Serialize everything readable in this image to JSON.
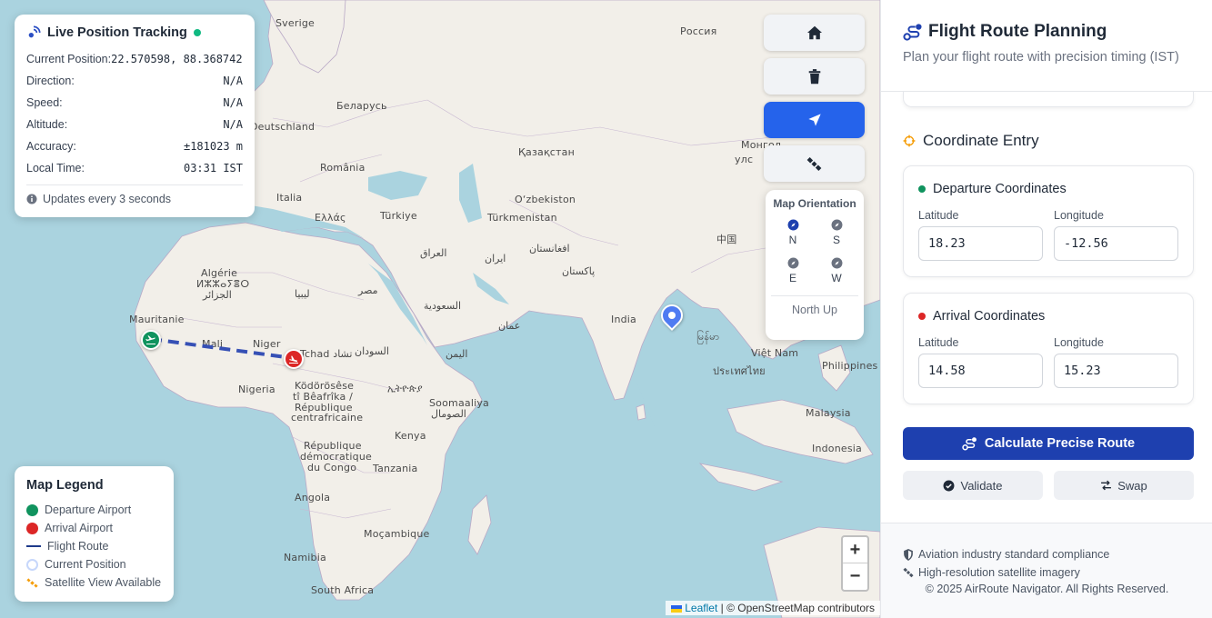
{
  "map": {
    "places": [
      {
        "name": "Sverige"
      },
      {
        "name": "Россия"
      },
      {
        "name": "Беларусь"
      },
      {
        "name": "Deutschland"
      },
      {
        "name": "România"
      },
      {
        "name": "Қазақстан"
      },
      {
        "name": "Italia"
      },
      {
        "name": "Ελλάς"
      },
      {
        "name": "Türkiye"
      },
      {
        "name": "O‘zbekiston"
      },
      {
        "name": "Türkmenistan"
      },
      {
        "name": "Монгол"
      },
      {
        "name": "улс"
      },
      {
        "name": "中国"
      },
      {
        "name": "افغانستان"
      },
      {
        "name": "العراق"
      },
      {
        "name": "ایران"
      },
      {
        "name": "پاکستان"
      },
      {
        "name": "Algérie"
      },
      {
        "name": "ⵍⵣⵣⴰⵢⴻⵔ"
      },
      {
        "name": "الجزائر"
      },
      {
        "name": "ليبيا"
      },
      {
        "name": "مصر"
      },
      {
        "name": "السعودية"
      },
      {
        "name": "India"
      },
      {
        "name": "Mauritanie"
      },
      {
        "name": "Mali"
      },
      {
        "name": "Niger"
      },
      {
        "name": "Tchad تشاد"
      },
      {
        "name": "السودان"
      },
      {
        "name": "اليمن"
      },
      {
        "name": "عمان"
      },
      {
        "name": "Nigeria"
      },
      {
        "name": "Ködörösêse"
      },
      {
        "name": "tî Bêafrîka /"
      },
      {
        "name": "République"
      },
      {
        "name": "centrafricaine"
      },
      {
        "name": "ኢትዮጵያ"
      },
      {
        "name": "Soomaaliya"
      },
      {
        "name": "الصومال"
      },
      {
        "name": "Kenya"
      },
      {
        "name": "République"
      },
      {
        "name": "démocratique"
      },
      {
        "name": "du Congo"
      },
      {
        "name": "Tanzania"
      },
      {
        "name": "Angola"
      },
      {
        "name": "Moçambique"
      },
      {
        "name": "Namibia"
      },
      {
        "name": "South Africa"
      },
      {
        "name": "Việt Nam"
      },
      {
        "name": "Philippines"
      },
      {
        "name": "Malaysia"
      },
      {
        "name": "Indonesia"
      },
      {
        "name": "ประเทศไทย"
      },
      {
        "name": "မြန်မာ"
      }
    ],
    "attribution": {
      "leaflet": "Leaflet",
      "rest": "| © OpenStreetMap contributors"
    }
  },
  "tracking": {
    "title": "Live Position Tracking",
    "rows": [
      {
        "label": "Current Position:",
        "value": "22.570598, 88.368742"
      },
      {
        "label": "Direction:",
        "value": "N/A"
      },
      {
        "label": "Speed:",
        "value": "N/A"
      },
      {
        "label": "Altitude:",
        "value": "N/A"
      },
      {
        "label": "Accuracy:",
        "value": "±181023 m"
      },
      {
        "label": "Local Time:",
        "value": "03:31 IST"
      }
    ],
    "note": "Updates every 3 seconds"
  },
  "legend": {
    "title": "Map Legend",
    "items": [
      {
        "label": "Departure Airport",
        "color": "#10935e"
      },
      {
        "label": "Arrival Airport",
        "color": "#dc2626"
      },
      {
        "label": "Flight Route",
        "color": "#1e3a8a"
      },
      {
        "label": "Current Position",
        "color": "#93c5fd"
      },
      {
        "label": "Satellite View Available",
        "color": "#f59e0b"
      }
    ]
  },
  "controls": {
    "home": "home-icon",
    "delete": "trash-icon",
    "locate": "location-arrow-icon",
    "satellite": "satellite-icon"
  },
  "orientation": {
    "title": "Map Orientation",
    "options": [
      "N",
      "S",
      "E",
      "W"
    ],
    "footer": "North Up"
  },
  "zoom": {
    "in": "+",
    "out": "−"
  },
  "panel": {
    "title": "Flight Route Planning",
    "subtitle": "Plan your flight route with precision timing (IST)",
    "section_title": "Coordinate Entry",
    "departure": {
      "title": "Departure Coordinates",
      "lat_label": "Latitude",
      "lon_label": "Longitude",
      "lat": "18.23",
      "lon": "-12.56",
      "color": "#10935e"
    },
    "arrival": {
      "title": "Arrival Coordinates",
      "lat_label": "Latitude",
      "lon_label": "Longitude",
      "lat": "14.58",
      "lon": "15.23",
      "color": "#dc2626"
    },
    "calculate_label": "Calculate Precise Route",
    "validate_label": "Validate",
    "swap_label": "Swap",
    "footer": {
      "line1": "Aviation industry standard compliance",
      "line2": "High-resolution satellite imagery",
      "copyright": "© 2025 AirRoute Navigator. All Rights Reserved."
    }
  },
  "colors": {
    "accent": "#1e40af",
    "active": "#2563eb",
    "route": "#3650b5"
  }
}
